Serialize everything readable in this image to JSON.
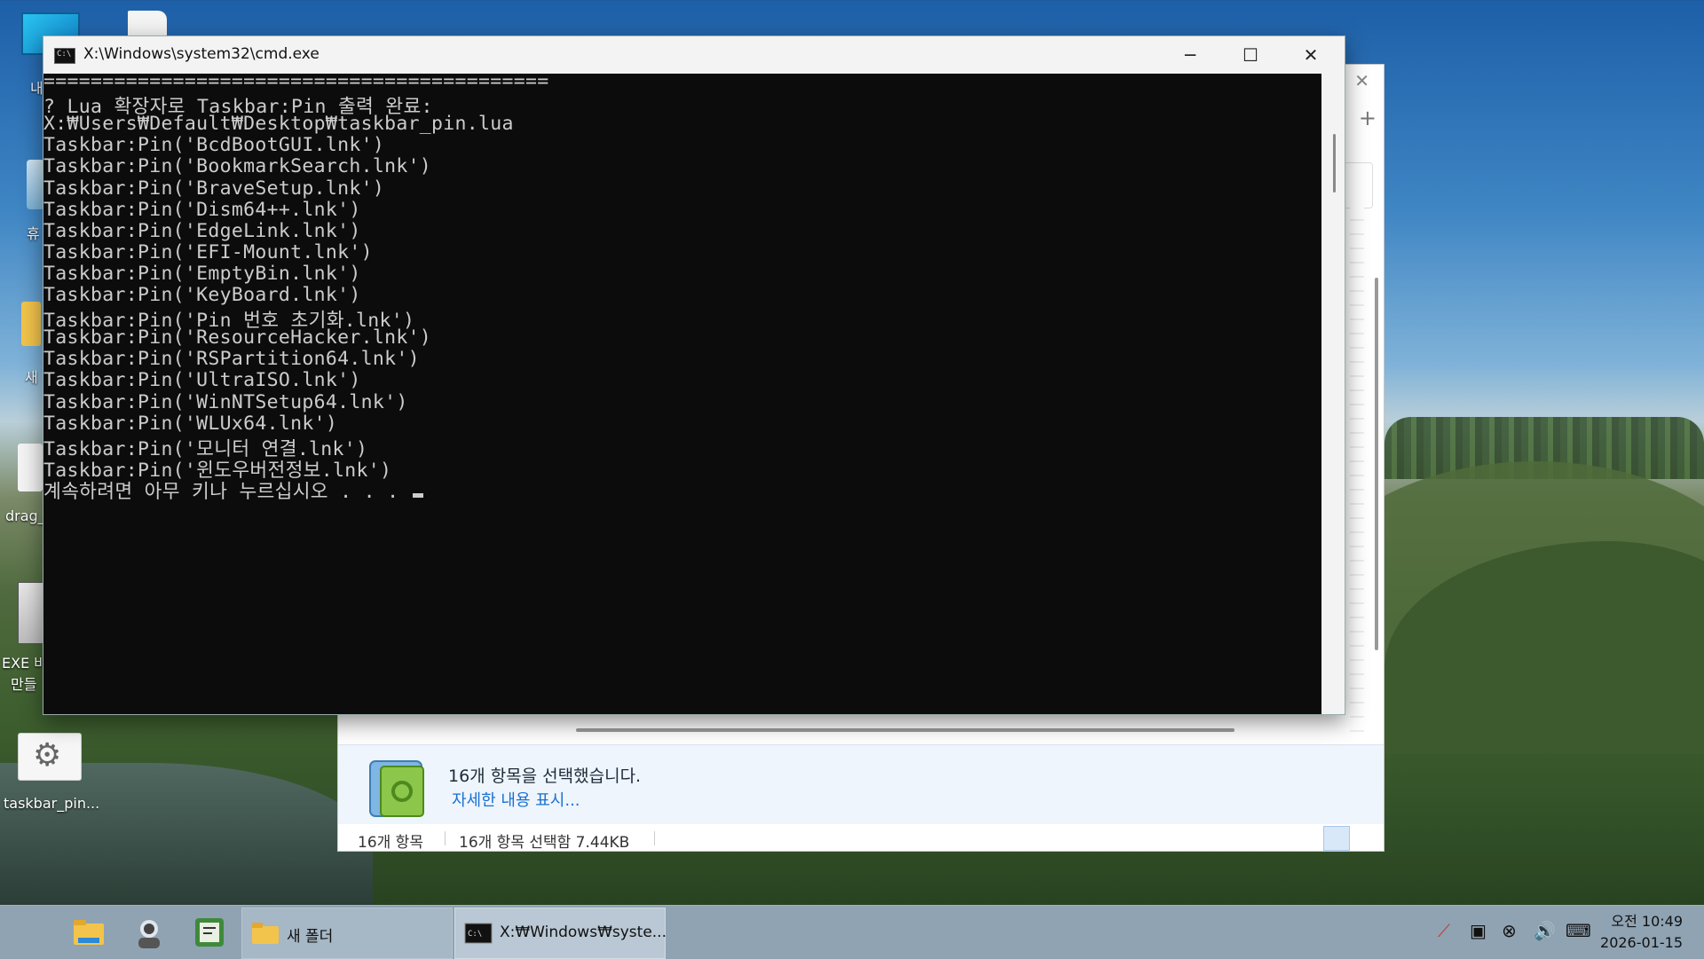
{
  "desktop": {
    "icons": [
      {
        "label": "내",
        "icon": "monitor-icon"
      },
      {
        "label": "휴",
        "icon": "recycle-bin-icon"
      },
      {
        "label": "새",
        "icon": "folder-icon"
      },
      {
        "label": "drag_",
        "icon": "settings-file-icon"
      },
      {
        "label": "EXE 바",
        "label2": "만들",
        "icon": "exe-builder-icon"
      },
      {
        "label": "taskbar_pin...",
        "icon": "gear-file-icon"
      }
    ]
  },
  "explorer": {
    "selection_text": "16개 항목을 선택했습니다.",
    "details_link": "자세한 내용 표시...",
    "status_count": "16개 항목",
    "status_selected": "16개 항목 선택함 7.44KB"
  },
  "cmd": {
    "title": "X:\\Windows\\system32\\cmd.exe",
    "lines": [
      "===========================================",
      "? Lua 확장자로 Taskbar:Pin 출력 완료:",
      "X:₩Users₩Default₩Desktop₩taskbar_pin.lua",
      "Taskbar:Pin('BcdBootGUI.lnk')",
      "Taskbar:Pin('BookmarkSearch.lnk')",
      "Taskbar:Pin('BraveSetup.lnk')",
      "Taskbar:Pin('Dism64++.lnk')",
      "Taskbar:Pin('EdgeLink.lnk')",
      "Taskbar:Pin('EFI-Mount.lnk')",
      "Taskbar:Pin('EmptyBin.lnk')",
      "Taskbar:Pin('KeyBoard.lnk')",
      "Taskbar:Pin('Pin 번호 초기화.lnk')",
      "Taskbar:Pin('ResourceHacker.lnk')",
      "Taskbar:Pin('RSPartition64.lnk')",
      "Taskbar:Pin('UltraISO.lnk')",
      "Taskbar:Pin('WinNTSetup64.lnk')",
      "Taskbar:Pin('WLUx64.lnk')",
      "Taskbar:Pin('모니터 연결.lnk')",
      "Taskbar:Pin('윈도우버전정보.lnk')",
      "계속하려면 아무 키나 누르십시오 . . ."
    ]
  },
  "taskbar": {
    "tasks": [
      {
        "label": "새 폴더",
        "icon": "folder-icon"
      },
      {
        "label": "X:₩Windows₩syste...",
        "icon": "cmd-icon"
      }
    ],
    "clock_time": "오전 10:49",
    "clock_date": "2026-01-15"
  },
  "colors": {
    "console_bg": "#0c0c0c",
    "console_fg": "#cccccc",
    "link": "#1a6fd1",
    "taskbar": "#8fa3b3"
  }
}
